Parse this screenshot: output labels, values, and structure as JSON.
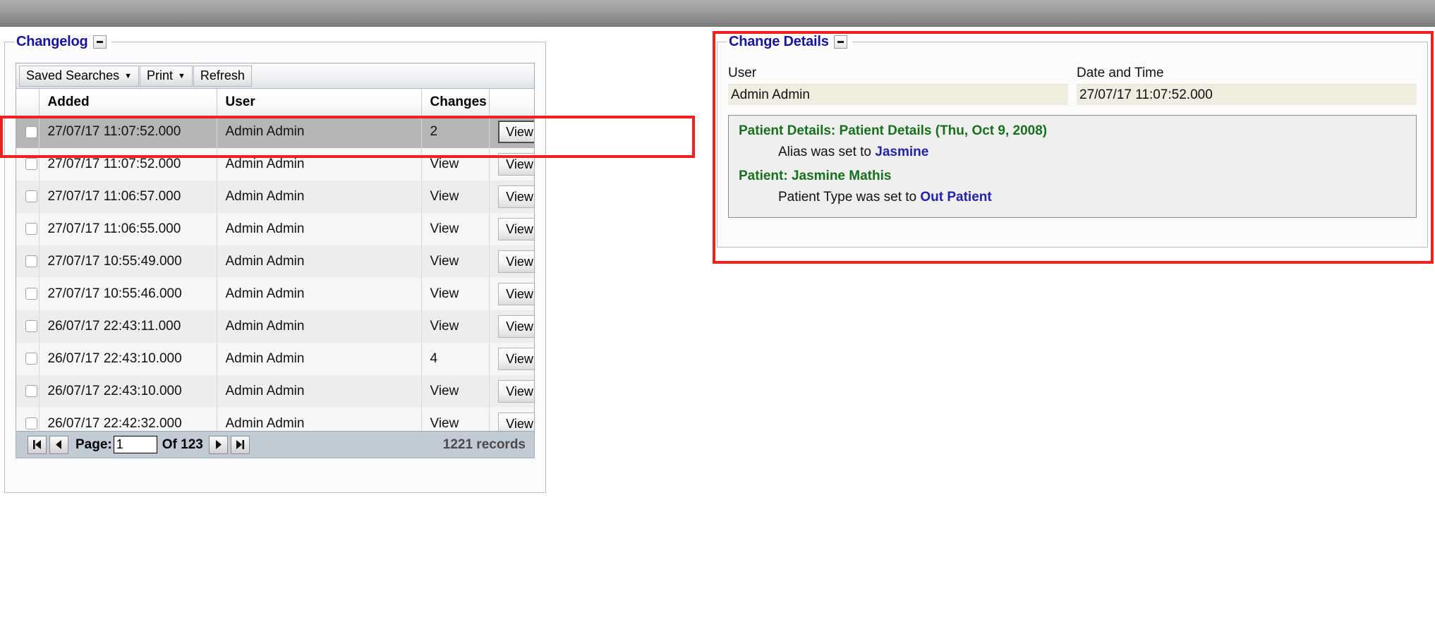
{
  "changelog": {
    "title": "Changelog",
    "collapse_icon": "minus-icon",
    "toolbar": {
      "saved_searches_label": "Saved Searches",
      "print_label": "Print",
      "refresh_label": "Refresh",
      "dropdown_icon": "caret-down-icon"
    },
    "columns": [
      "Added",
      "User",
      "Changes"
    ],
    "rows": [
      {
        "added": "27/07/17 11:07:52.000",
        "user": "Admin Admin",
        "changes": "2",
        "action": "View",
        "selected": true
      },
      {
        "added": "27/07/17 11:07:52.000",
        "user": "Admin Admin",
        "changes": "View",
        "action": "View",
        "selected": false
      },
      {
        "added": "27/07/17 11:06:57.000",
        "user": "Admin Admin",
        "changes": "View",
        "action": "View",
        "selected": false
      },
      {
        "added": "27/07/17 11:06:55.000",
        "user": "Admin Admin",
        "changes": "View",
        "action": "View",
        "selected": false
      },
      {
        "added": "27/07/17 10:55:49.000",
        "user": "Admin Admin",
        "changes": "View",
        "action": "View",
        "selected": false
      },
      {
        "added": "27/07/17 10:55:46.000",
        "user": "Admin Admin",
        "changes": "View",
        "action": "View",
        "selected": false
      },
      {
        "added": "26/07/17 22:43:11.000",
        "user": "Admin Admin",
        "changes": "View",
        "action": "View",
        "selected": false
      },
      {
        "added": "26/07/17 22:43:10.000",
        "user": "Admin Admin",
        "changes": "4",
        "action": "View",
        "selected": false
      },
      {
        "added": "26/07/17 22:43:10.000",
        "user": "Admin Admin",
        "changes": "View",
        "action": "View",
        "selected": false
      },
      {
        "added": "26/07/17 22:42:32.000",
        "user": "Admin Admin",
        "changes": "View",
        "action": "View",
        "selected": false
      }
    ],
    "pager": {
      "first_icon": "first-page-icon",
      "prev_icon": "previous-page-icon",
      "next_icon": "next-page-icon",
      "last_icon": "last-page-icon",
      "page_label": "Page:",
      "page_value": "1",
      "of_label": "Of 123",
      "records_label": "1221 records"
    }
  },
  "change_details": {
    "title": "Change Details",
    "collapse_icon": "minus-icon",
    "user_label": "User",
    "user_value": "Admin Admin",
    "datetime_label": "Date and Time",
    "datetime_value": "27/07/17 11:07:52.000",
    "entries": [
      {
        "heading": "Patient Details: Patient Details (Thu, Oct 9, 2008)",
        "line_prefix": "Alias was set to ",
        "line_value": "Jasmine"
      },
      {
        "heading": "Patient: Jasmine Mathis",
        "line_prefix": "Patient Type was set to ",
        "line_value": "Out Patient"
      }
    ]
  },
  "colors": {
    "legend_blue": "#1414a0",
    "heading_green": "#17701c",
    "link_blue": "#2222aa",
    "annotation_red": "#ee2222",
    "selected_row": "#b5b5b5",
    "footer_blue_gray": "#c2cad4",
    "value_cream": "#efeddf"
  }
}
